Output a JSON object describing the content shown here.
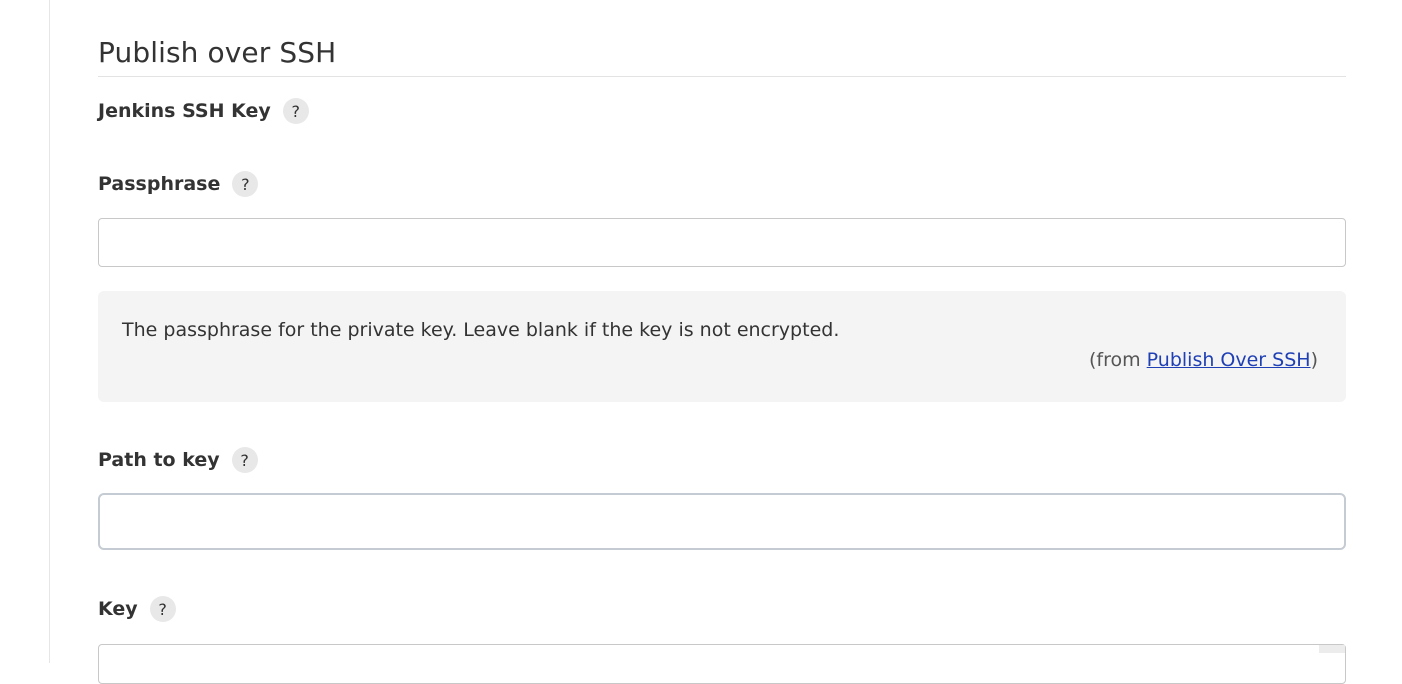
{
  "section": {
    "title": "Publish over SSH"
  },
  "fields": {
    "jenkins_ssh_key": {
      "label": "Jenkins SSH Key",
      "help": "?"
    },
    "passphrase": {
      "label": "Passphrase",
      "help": "?",
      "value": "",
      "help_text": "The passphrase for the private key. Leave blank if the key is not encrypted.",
      "help_from_prefix": "(from ",
      "help_from_link": "Publish Over SSH",
      "help_from_suffix": ")"
    },
    "path_to_key": {
      "label": "Path to key",
      "help": "?",
      "value": ""
    },
    "key": {
      "label": "Key",
      "help": "?",
      "value": ""
    }
  },
  "colors": {
    "link": "#1f3fb4",
    "help_box_bg": "#f4f4f4",
    "focus_border": "#c5cbd3"
  }
}
